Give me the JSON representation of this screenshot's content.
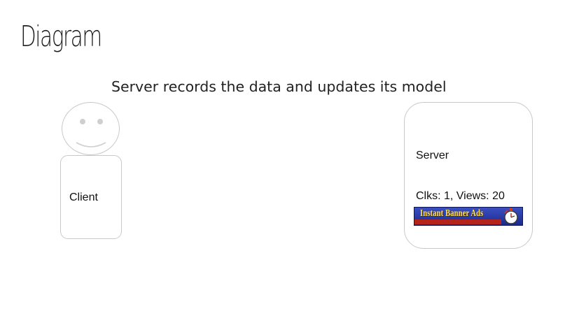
{
  "slide": {
    "title": "Diagram",
    "caption": "Server records the data and updates its model"
  },
  "client": {
    "label": "Client"
  },
  "server": {
    "label": "Server",
    "stats": "Clks: 1, Views: 20",
    "banner": {
      "title": "Instant Banner Ads",
      "icon": "stopwatch-icon",
      "colors": {
        "background": "#2a3aa8",
        "title": "#ffe24a",
        "strip": "#b5241a"
      }
    }
  }
}
